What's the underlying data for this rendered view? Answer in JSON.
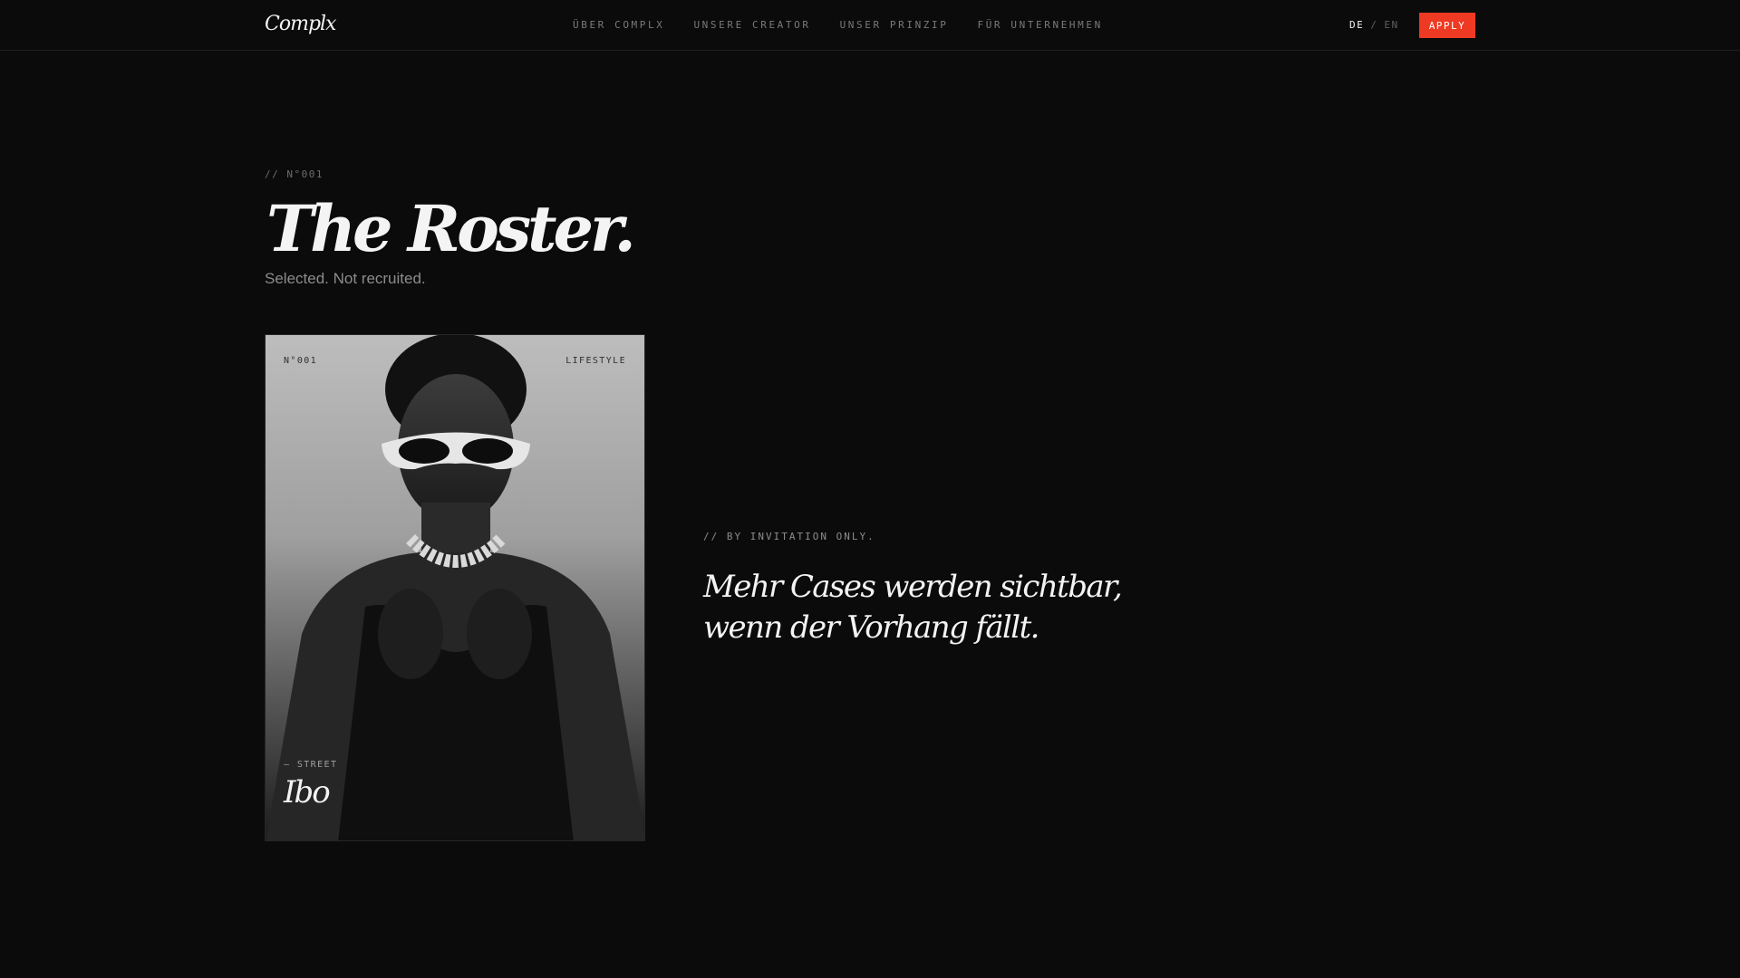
{
  "header": {
    "logo": "Complx",
    "nav": [
      "ÜBER COMPLX",
      "UNSERE CREATOR",
      "UNSER PRINZIP",
      "FÜR UNTERNEHMEN"
    ],
    "lang_active": "DE",
    "lang_sep": "/",
    "lang_inactive": "EN",
    "apply_label": "APPLY",
    "accent_color": "#ee3a23"
  },
  "intro": {
    "eyebrow": "// N°001",
    "title": "The Roster.",
    "subtitle": "Selected. Not recruited."
  },
  "card": {
    "number": "N°001",
    "category": "LIFESTYLE",
    "tag": "— STREET",
    "name": "Ibo",
    "image": "portrait-photo"
  },
  "invite": {
    "eyebrow": "// BY INVITATION ONLY.",
    "quote": "Mehr Cases werden sichtbar, wenn der Vorhang fällt."
  }
}
